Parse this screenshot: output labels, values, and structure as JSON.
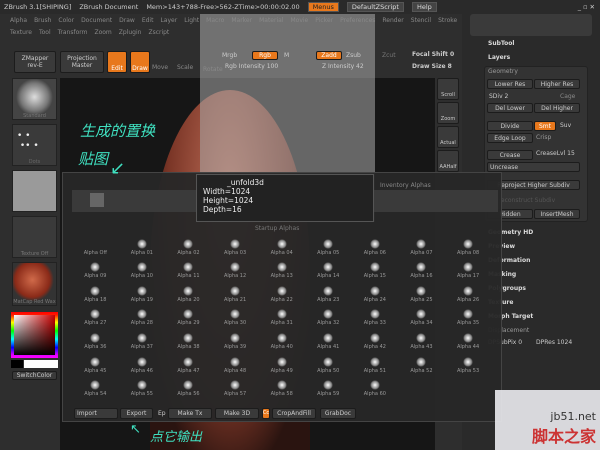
{
  "titlebar": {
    "app": "ZBrush 3.1[SHIPING]",
    "doc": "ZBrush Document",
    "mem": "Mem>143+788-Free>562-ZTime>00:00:02.00",
    "menus": "Menus",
    "script": "DefaultZScript",
    "help": "Help"
  },
  "menu_row1": [
    "Alpha",
    "Brush",
    "Color",
    "Document",
    "Draw",
    "Edit",
    "Layer",
    "Light",
    "Macro",
    "Marker",
    "Material",
    "Movie",
    "Picker",
    "Preferences",
    "Render",
    "Stencil",
    "Stroke"
  ],
  "menu_row2": [
    "Texture",
    "Tool",
    "Transform",
    "Zoom",
    "Zplugin",
    "Zscript"
  ],
  "toolbar": {
    "zmapper": "ZMapper",
    "zmapper_sub": "rev-E",
    "projection": "Projection",
    "projection_sub": "Master",
    "edit": "Edit",
    "draw": "Draw",
    "move": "Move",
    "scale": "Scale",
    "rotate": "Rotate",
    "mrgb": "Mrgb",
    "rgb": "Rgb",
    "m": "M",
    "zadd": "Zadd",
    "zsub": "Zsub",
    "zcut": "Zcut",
    "rgb_intensity": "Rgb Intensity 100",
    "z_intensity": "Z Intensity 42",
    "focal_shift": "Focal Shift 0",
    "draw_size": "Draw Size 8"
  },
  "shelf": {
    "brush": "Standard",
    "stroke": "Dots",
    "texture": "Texture Off",
    "material": "MatCap Red Wax",
    "switch_color": "SwitchColor"
  },
  "nav": [
    "Scroll",
    "Zoom",
    "Actual",
    "AAHalf"
  ],
  "right": {
    "subtool": "SubTool",
    "layers": "Layers",
    "geometry": "Geometry",
    "lower_res": "Lower Res",
    "higher_res": "Higher Res",
    "sdiv": "SDiv 2",
    "cage": "Cage",
    "del_lower": "Del Lower",
    "del_higher": "Del Higher",
    "divide": "Divide",
    "smt": "Smt",
    "suv": "Suv",
    "edge_loop": "Edge Loop",
    "crisp": "Crisp",
    "crease": "Crease",
    "crease_lvl": "CreaseLvl 15",
    "uncrease": "Uncrease",
    "reproject": "Reproject Higher Subdiv",
    "reconstruct": "Reconstruct Subdiv",
    "hidden": "Hidden",
    "insertmesh": "InsertMesh",
    "geometry_hd": "Geometry HD",
    "preview": "Preview",
    "deformation": "Deformation",
    "masking": "Masking",
    "polygroups": "Polygroups",
    "texture": "Texture",
    "morph_target": "Morph Target",
    "displacement": "Displacement",
    "dpsubpix": "DPSubPix 0",
    "dpres": "DPRes 1024"
  },
  "popup": {
    "section1": "Inventory Alphas",
    "section2": "Startup Alphas",
    "tooltip_name": "_unfold3d",
    "width": "Width=1024",
    "height": "Height=1024",
    "depth": "Depth=16",
    "alphas": [
      "Alpha Off",
      "Alpha 01",
      "Alpha 02",
      "Alpha 03",
      "Alpha 04",
      "Alpha 05",
      "Alpha 06",
      "Alpha 07",
      "Alpha 08",
      "Alpha 09",
      "Alpha 10",
      "Alpha 11",
      "Alpha 12",
      "Alpha 13",
      "Alpha 14",
      "Alpha 15",
      "Alpha 16",
      "Alpha 17",
      "Alpha 18",
      "Alpha 19",
      "Alpha 20",
      "Alpha 21",
      "Alpha 22",
      "Alpha 23",
      "Alpha 24",
      "Alpha 25",
      "Alpha 26",
      "Alpha 27",
      "Alpha 28",
      "Alpha 29",
      "Alpha 30",
      "Alpha 31",
      "Alpha 32",
      "Alpha 33",
      "Alpha 34",
      "Alpha 35",
      "Alpha 36",
      "Alpha 37",
      "Alpha 38",
      "Alpha 39",
      "Alpha 40",
      "Alpha 41",
      "Alpha 42",
      "Alpha 43",
      "Alpha 44",
      "Alpha 45",
      "Alpha 46",
      "Alpha 47",
      "Alpha 48",
      "Alpha 49",
      "Alpha 50",
      "Alpha 51",
      "Alpha 52",
      "Alpha 53",
      "Alpha 54",
      "Alpha 55",
      "Alpha 56",
      "Alpha 57",
      "Alpha 58",
      "Alpha 59",
      "Alpha 60"
    ],
    "import": "Import",
    "export": "Export",
    "ep": "Ep",
    "make_tx": "Make Tx",
    "make_3d": "Make 3D",
    "cc": "Cc",
    "crop_fill": "CropAndFill",
    "grabdoc": "GrabDoc"
  },
  "annotations": {
    "top": "生成的置换",
    "top2": "贴图",
    "bottom": "点它输出"
  },
  "watermark": {
    "site": "jb51.net",
    "name": "脚本之家"
  },
  "colors": {
    "accent": "#e8781c",
    "annotation": "#3fe0c0"
  }
}
